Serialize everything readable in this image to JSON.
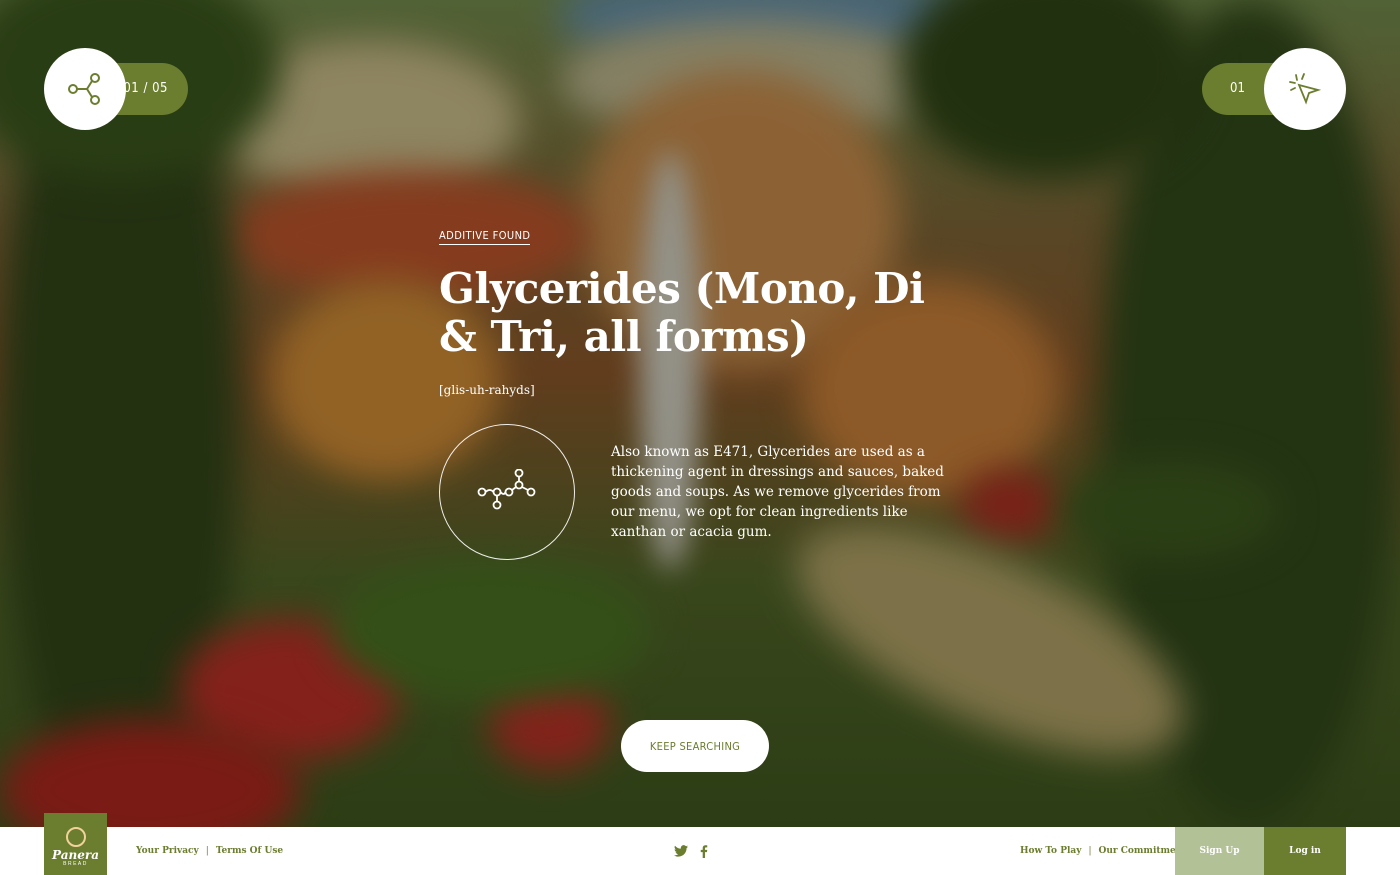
{
  "nav": {
    "progress": "01 / 05",
    "found_count": "01",
    "share_icon": "share-icon",
    "cursor_icon": "cursor-sparkle-icon"
  },
  "additive": {
    "eyebrow": "Additive Found",
    "name": "Glycerides (Mono, Di & Tri, all forms)",
    "pronunciation": "[glis-uh-rahyds]",
    "description": "Also known as E471, Glycerides are used as a thickening agent in dressings and sauces, baked goods and soups. As we remove glycerides from our menu, we opt for clean ingredients like xanthan or acacia gum.",
    "icon": "molecule-icon"
  },
  "cta": {
    "keep_searching": "Keep Searching"
  },
  "footer": {
    "logo_word": "Panera",
    "logo_sub": "BREAD",
    "left_links": [
      "Your Privacy",
      "Terms Of Use"
    ],
    "right_links": [
      "How To Play",
      "Our Commitment"
    ],
    "social": [
      "twitter-icon",
      "facebook-icon"
    ],
    "signup": "Sign Up",
    "login": "Log in"
  },
  "colors": {
    "brand": "#6b7d2e",
    "brand_light": "#b3c196",
    "white": "#ffffff"
  }
}
